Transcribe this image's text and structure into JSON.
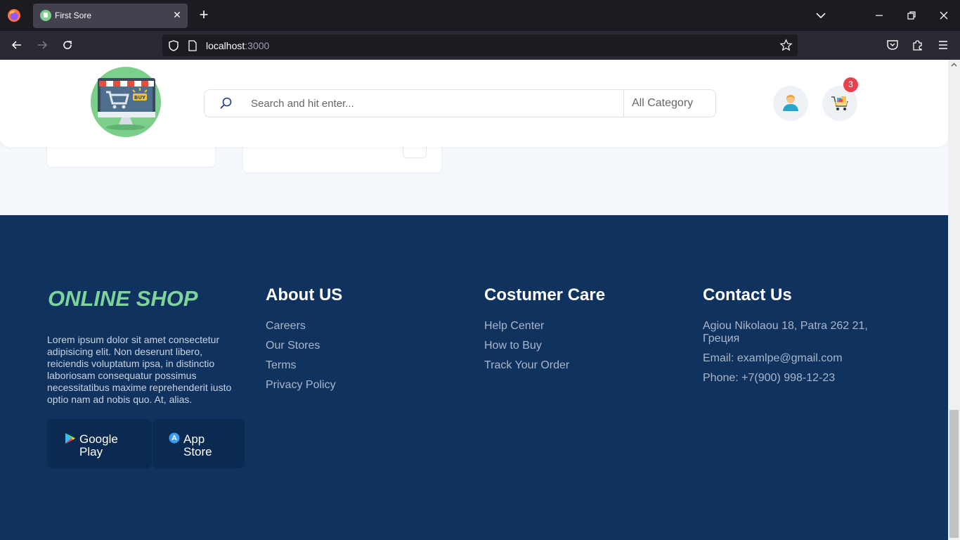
{
  "browser": {
    "tab_title": "First Sore",
    "url_host": "localhost",
    "url_port": ":3000"
  },
  "header": {
    "search_placeholder": "Search and hit enter...",
    "category_label": "All Category",
    "cart_count": "3"
  },
  "footer": {
    "brand": "ONLINE SHOP",
    "description": "Lorem ipsum dolor sit amet consectetur adipisicing elit. Non deserunt libero, reiciendis voluptatum ipsa, in distinctio laboriosam consequatur possimus necessitatibus maxime reprehenderit iusto optio nam ad nobis quo. At, alias.",
    "google_play": {
      "line1": "Google",
      "line2": "Play"
    },
    "app_store": {
      "line1": "App",
      "line2": "Store"
    },
    "about": {
      "title": "About US",
      "links": [
        "Careers",
        "Our Stores",
        "Terms",
        "Privacy Policy"
      ]
    },
    "care": {
      "title": "Costumer Care",
      "links": [
        "Help Center",
        "How to Buy",
        "Track Your Order"
      ]
    },
    "contact": {
      "title": "Contact Us",
      "address_line1": "Agiou Nikolaou 18, Patra 262 21,",
      "address_line2": "Греция",
      "email": "Email: examlpe@gmail.com",
      "phone": "Phone: +7(900) 998-12-23"
    }
  },
  "colors": {
    "footer_bg": "#0f325f",
    "brand_green": "#7ed39b",
    "badge_red": "#e8414d"
  }
}
